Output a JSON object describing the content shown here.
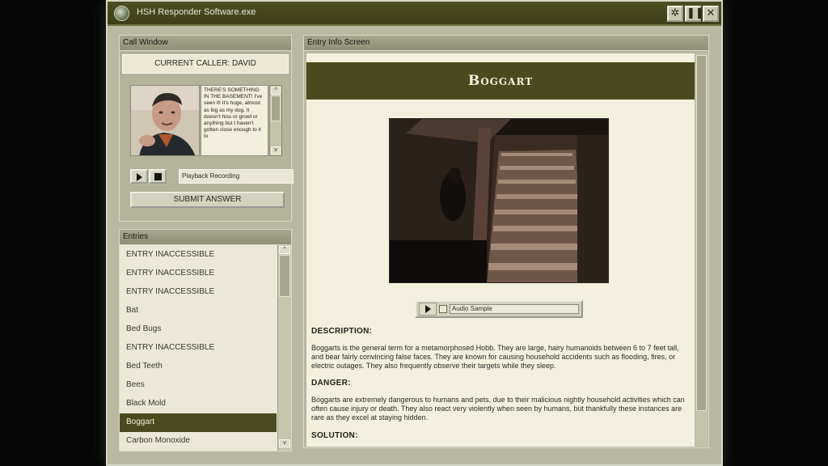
{
  "window": {
    "title": "HSH Responder Software.exe"
  },
  "call_window": {
    "header": "Call Window",
    "current_caller": "CURRENT CALLER: DAVID",
    "transcript": "THERE'S SOMETHING IN THE BASEMENT! I've seen it! It's huge, almost as big as my dog. It doesn't hiss or growl or anything but I haven't gotten close enough to it to",
    "playback_label": "Playback Recording",
    "submit_label": "SUBMIT ANSWER"
  },
  "entries": {
    "header": "Entries",
    "items": [
      "ENTRY INACCESSIBLE",
      "ENTRY INACCESSIBLE",
      "ENTRY INACCESSIBLE",
      "Bat",
      "Bed Bugs",
      "ENTRY INACCESSIBLE",
      "Bed Teeth",
      "Bees",
      "Black Mold",
      "Boggart",
      "Carbon Monoxide"
    ],
    "selected_index": 9
  },
  "info_screen": {
    "header": "Entry Info Screen",
    "entry_title": "Boggart",
    "audio_label": "Audio Sample",
    "description_heading": "DESCRIPTION:",
    "description_text": "Boggarts is the general term for a metamorphosed Hobb. They are large, hairy humanoids between 6 to 7 feet tall, and bear fairly convincing false faces. They are known for causing household accidents such as flooding, fires, or electric outages. They also frequently observe their targets while they sleep.",
    "danger_heading": "DANGER:",
    "danger_text": "Boggarts are extremely dangerous to humans and pets, due to their malicious nightly household activities which can often cause injury or death. They also react very violently when seen by humans, but thankfully these instances are rare as they excel at staying hidden.",
    "solution_heading": "SOLUTION:"
  },
  "icons": [
    "app-icon",
    "settings-icon",
    "pause-icon",
    "close-icon",
    "play-icon",
    "stop-icon"
  ]
}
